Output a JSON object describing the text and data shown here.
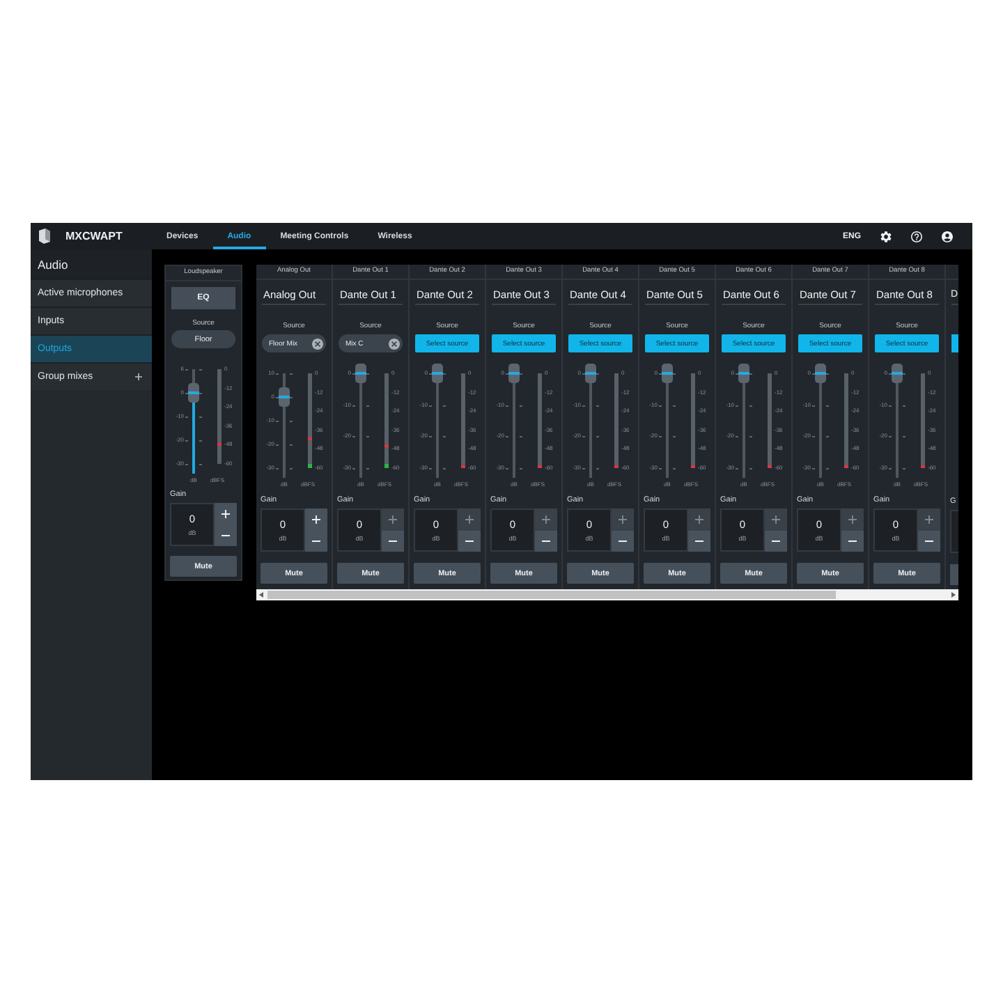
{
  "top_bar": {
    "product": "MXCWAPT",
    "tabs": [
      {
        "label": "Devices",
        "selected": false
      },
      {
        "label": "Audio",
        "selected": true
      },
      {
        "label": "Meeting Controls",
        "selected": false
      },
      {
        "label": "Wireless",
        "selected": false
      }
    ],
    "language": "ENG"
  },
  "sidebar": {
    "title": "Audio",
    "items": [
      {
        "label": "Active microphones",
        "selected": false,
        "addable": false
      },
      {
        "label": "Inputs",
        "selected": false,
        "addable": false
      },
      {
        "label": "Outputs",
        "selected": true,
        "addable": false
      },
      {
        "label": "Group mixes",
        "selected": false,
        "addable": true
      }
    ]
  },
  "loudspeaker": {
    "header": "Loudspeaker",
    "eq_button": "EQ",
    "source_label": "Source",
    "source": {
      "kind": "selector",
      "label": "Floor"
    },
    "fader": {
      "scale": [
        "6",
        "0",
        "-10",
        "-20",
        "-30"
      ],
      "unit": "dB",
      "level": 0.75,
      "active": true
    },
    "meter": {
      "scale": [
        "0",
        "-12",
        "-24",
        "-36",
        "-48",
        "-60"
      ],
      "unit": "dBFS",
      "peak": {
        "level": 0.2
      }
    },
    "gain": {
      "label": "Gain",
      "value": "0",
      "unit": "dB",
      "increase_disabled": false
    },
    "mute_button": "Mute"
  },
  "outputs": [
    {
      "header": "Analog Out",
      "title": "Analog Out",
      "source_label": "Source",
      "source": {
        "kind": "chip",
        "label": "Floor Mix"
      },
      "fader": {
        "scale": [
          "10",
          "0",
          "-10",
          "-20",
          "-30"
        ],
        "unit": "dB",
        "level": 0.75,
        "active": false
      },
      "meter": {
        "scale": [
          "0",
          "-12",
          "-24",
          "-36",
          "-48",
          "-60"
        ],
        "unit": "dBFS",
        "level": 0.05,
        "peak": {
          "level": 0.3
        }
      },
      "gain": {
        "label": "Gain",
        "value": "0",
        "unit": "dB",
        "increase_disabled": false
      },
      "mute_button": "Mute"
    },
    {
      "header": "Dante Out 1",
      "title": "Dante Out 1",
      "source_label": "Source",
      "source": {
        "kind": "chip",
        "label": "Mix C"
      },
      "fader": {
        "scale": [
          "0",
          "-10",
          "-20",
          "-30"
        ],
        "unit": "dB",
        "level": 1,
        "active": false
      },
      "meter": {
        "scale": [
          "0",
          "-12",
          "-24",
          "-36",
          "-48",
          "-60"
        ],
        "unit": "dBFS",
        "level": 0.05,
        "peak": {
          "level": 0.22
        }
      },
      "gain": {
        "label": "Gain",
        "value": "0",
        "unit": "dB",
        "increase_disabled": true
      },
      "mute_button": "Mute"
    },
    {
      "header": "Dante Out 2",
      "title": "Dante Out 2",
      "source_label": "Source",
      "source": {
        "kind": "button",
        "label": "Select source"
      },
      "fader": {
        "scale": [
          "0",
          "-10",
          "-20",
          "-30"
        ],
        "unit": "dB",
        "level": 1,
        "active": false
      },
      "meter": {
        "scale": [
          "0",
          "-12",
          "-24",
          "-36",
          "-48",
          "-60"
        ],
        "unit": "dBFS",
        "peak": {
          "level": 0
        }
      },
      "gain": {
        "label": "Gain",
        "value": "0",
        "unit": "dB",
        "increase_disabled": true
      },
      "mute_button": "Mute"
    },
    {
      "header": "Dante Out 3",
      "title": "Dante Out 3",
      "source_label": "Source",
      "source": {
        "kind": "button",
        "label": "Select source"
      },
      "fader": {
        "scale": [
          "0",
          "-10",
          "-20",
          "-30"
        ],
        "unit": "dB",
        "level": 1,
        "active": false
      },
      "meter": {
        "scale": [
          "0",
          "-12",
          "-24",
          "-36",
          "-48",
          "-60"
        ],
        "unit": "dBFS",
        "peak": {
          "level": 0
        }
      },
      "gain": {
        "label": "Gain",
        "value": "0",
        "unit": "dB",
        "increase_disabled": true
      },
      "mute_button": "Mute"
    },
    {
      "header": "Dante Out 4",
      "title": "Dante Out 4",
      "source_label": "Source",
      "source": {
        "kind": "button",
        "label": "Select source"
      },
      "fader": {
        "scale": [
          "0",
          "-10",
          "-20",
          "-30"
        ],
        "unit": "dB",
        "level": 1,
        "active": false
      },
      "meter": {
        "scale": [
          "0",
          "-12",
          "-24",
          "-36",
          "-48",
          "-60"
        ],
        "unit": "dBFS",
        "peak": {
          "level": 0
        }
      },
      "gain": {
        "label": "Gain",
        "value": "0",
        "unit": "dB",
        "increase_disabled": true
      },
      "mute_button": "Mute"
    },
    {
      "header": "Dante Out 5",
      "title": "Dante Out 5",
      "source_label": "Source",
      "source": {
        "kind": "button",
        "label": "Select source"
      },
      "fader": {
        "scale": [
          "0",
          "-10",
          "-20",
          "-30"
        ],
        "unit": "dB",
        "level": 1,
        "active": false
      },
      "meter": {
        "scale": [
          "0",
          "-12",
          "-24",
          "-36",
          "-48",
          "-60"
        ],
        "unit": "dBFS",
        "peak": {
          "level": 0
        }
      },
      "gain": {
        "label": "Gain",
        "value": "0",
        "unit": "dB",
        "increase_disabled": true
      },
      "mute_button": "Mute"
    },
    {
      "header": "Dante Out 6",
      "title": "Dante Out 6",
      "source_label": "Source",
      "source": {
        "kind": "button",
        "label": "Select source"
      },
      "fader": {
        "scale": [
          "0",
          "-10",
          "-20",
          "-30"
        ],
        "unit": "dB",
        "level": 1,
        "active": false
      },
      "meter": {
        "scale": [
          "0",
          "-12",
          "-24",
          "-36",
          "-48",
          "-60"
        ],
        "unit": "dBFS",
        "peak": {
          "level": 0
        }
      },
      "gain": {
        "label": "Gain",
        "value": "0",
        "unit": "dB",
        "increase_disabled": true
      },
      "mute_button": "Mute"
    },
    {
      "header": "Dante Out 7",
      "title": "Dante Out 7",
      "source_label": "Source",
      "source": {
        "kind": "button",
        "label": "Select source"
      },
      "fader": {
        "scale": [
          "0",
          "-10",
          "-20",
          "-30"
        ],
        "unit": "dB",
        "level": 1,
        "active": false
      },
      "meter": {
        "scale": [
          "0",
          "-12",
          "-24",
          "-36",
          "-48",
          "-60"
        ],
        "unit": "dBFS",
        "peak": {
          "level": 0
        }
      },
      "gain": {
        "label": "Gain",
        "value": "0",
        "unit": "dB",
        "increase_disabled": true
      },
      "mute_button": "Mute"
    },
    {
      "header": "Dante Out 8",
      "title": "Dante Out 8",
      "source_label": "Source",
      "source": {
        "kind": "button",
        "label": "Select source"
      },
      "fader": {
        "scale": [
          "0",
          "-10",
          "-20",
          "-30"
        ],
        "unit": "dB",
        "level": 1,
        "active": false
      },
      "meter": {
        "scale": [
          "0",
          "-12",
          "-24",
          "-36",
          "-48",
          "-60"
        ],
        "unit": "dBFS",
        "peak": {
          "level": 0
        }
      },
      "gain": {
        "label": "Gain",
        "value": "0",
        "unit": "dB",
        "increase_disabled": true
      },
      "mute_button": "Mute"
    }
  ],
  "partial_output": {
    "title": "D",
    "source": {
      "kind": "button"
    },
    "gain_label": "G"
  }
}
